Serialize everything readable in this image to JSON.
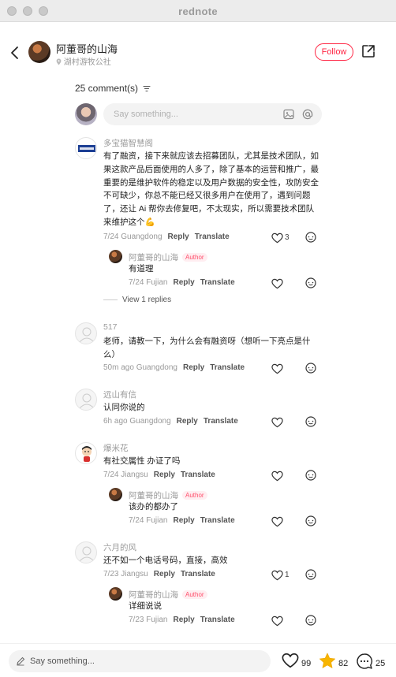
{
  "window": {
    "title": "rednote"
  },
  "header": {
    "author_name": "阿董哥的山海",
    "location": "湖村游牧公社",
    "follow_label": "Follow"
  },
  "comments_header": {
    "count_label": "25 comment(s)"
  },
  "top_input": {
    "placeholder": "Say something..."
  },
  "comments": [
    {
      "name": "多宝猫智慧阁",
      "text": "有了融资，接下来就应该去招募团队，尤其是技术团队，如果这款产品后面使用的人多了，除了基本的运营和推广，最重要的是维护软件的稳定以及用户数据的安全性，攻防安全不可缺少，你总不能已经又很多用户在使用了，遇到问题了，还让 Ai 帮你去修复吧，不太现实，所以需要技术团队来维护这个💪",
      "time_loc": "7/24 Guangdong",
      "reply": "Reply",
      "translate": "Translate",
      "likes": "3"
    },
    {
      "name": "517",
      "text": "老师，请教一下，为什么会有融资呀（想听一下亮点是什么）",
      "time_loc": "50m ago Guangdong",
      "reply": "Reply",
      "translate": "Translate",
      "likes": ""
    },
    {
      "name": "远山有信",
      "text": "认同你说的",
      "time_loc": "6h ago Guangdong",
      "reply": "Reply",
      "translate": "Translate",
      "likes": ""
    },
    {
      "name": "爆米花",
      "text": "有社交属性 办证了吗",
      "time_loc": "7/24 Jiangsu",
      "reply": "Reply",
      "translate": "Translate",
      "likes": ""
    },
    {
      "name": "六月的风",
      "text": "还不如一个电话号码，直接，高效",
      "time_loc": "7/23 Jiangsu",
      "reply": "Reply",
      "translate": "Translate",
      "likes": "1"
    }
  ],
  "replies": [
    {
      "name": "阿董哥的山海",
      "badge": "Author",
      "text": "有道理",
      "time_loc": "7/24 Fujian",
      "reply": "Reply",
      "translate": "Translate"
    },
    {
      "name": "阿董哥的山海",
      "badge": "Author",
      "text": "该办的都办了",
      "time_loc": "7/24 Fujian",
      "reply": "Reply",
      "translate": "Translate"
    },
    {
      "name": "阿董哥的山海",
      "badge": "Author",
      "text": "详细说说",
      "time_loc": "7/23 Fujian",
      "reply": "Reply",
      "translate": "Translate"
    }
  ],
  "view_replies_label": "View 1 replies",
  "bottom_bar": {
    "placeholder": "Say something...",
    "likes": "99",
    "favorites": "82",
    "comments": "25"
  },
  "colors": {
    "accent": "#ff2442",
    "favorite": "#f7b500",
    "author_badge_bg": "#ffeef1"
  },
  "icons": [
    "back-icon",
    "share-icon",
    "location-pin-icon",
    "sort-icon",
    "image-icon",
    "mention-icon",
    "heart-icon",
    "reply-bubble-icon",
    "pencil-icon",
    "star-icon",
    "comment-icon"
  ]
}
